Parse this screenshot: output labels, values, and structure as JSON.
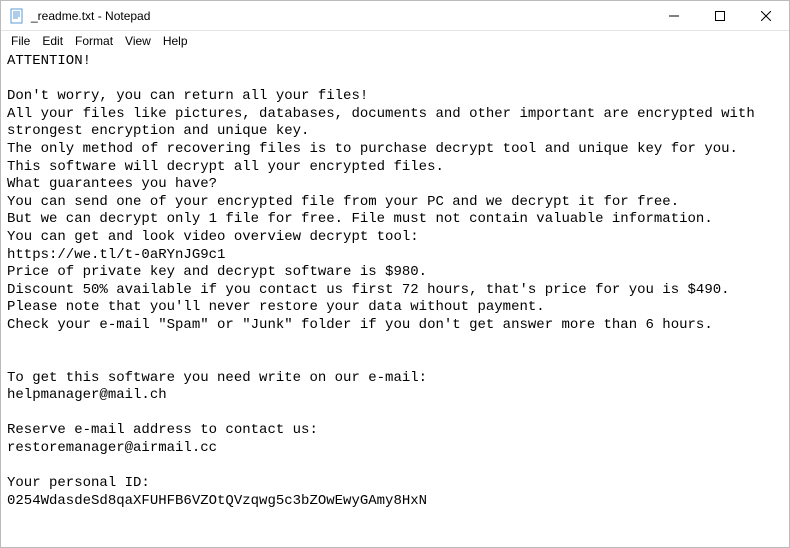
{
  "window": {
    "title": "_readme.txt - Notepad"
  },
  "menu": {
    "file": "File",
    "edit": "Edit",
    "format": "Format",
    "view": "View",
    "help": "Help"
  },
  "content": {
    "text": "ATTENTION!\n\nDon't worry, you can return all your files!\nAll your files like pictures, databases, documents and other important are encrypted with strongest encryption and unique key.\nThe only method of recovering files is to purchase decrypt tool and unique key for you.\nThis software will decrypt all your encrypted files.\nWhat guarantees you have?\nYou can send one of your encrypted file from your PC and we decrypt it for free.\nBut we can decrypt only 1 file for free. File must not contain valuable information.\nYou can get and look video overview decrypt tool:\nhttps://we.tl/t-0aRYnJG9c1\nPrice of private key and decrypt software is $980.\nDiscount 50% available if you contact us first 72 hours, that's price for you is $490.\nPlease note that you'll never restore your data without payment.\nCheck your e-mail \"Spam\" or \"Junk\" folder if you don't get answer more than 6 hours.\n\n\nTo get this software you need write on our e-mail:\nhelpmanager@mail.ch\n\nReserve e-mail address to contact us:\nrestoremanager@airmail.cc\n\nYour personal ID:\n0254WdasdeSd8qaXFUHFB6VZOtQVzqwg5c3bZOwEwyGAmy8HxN"
  }
}
